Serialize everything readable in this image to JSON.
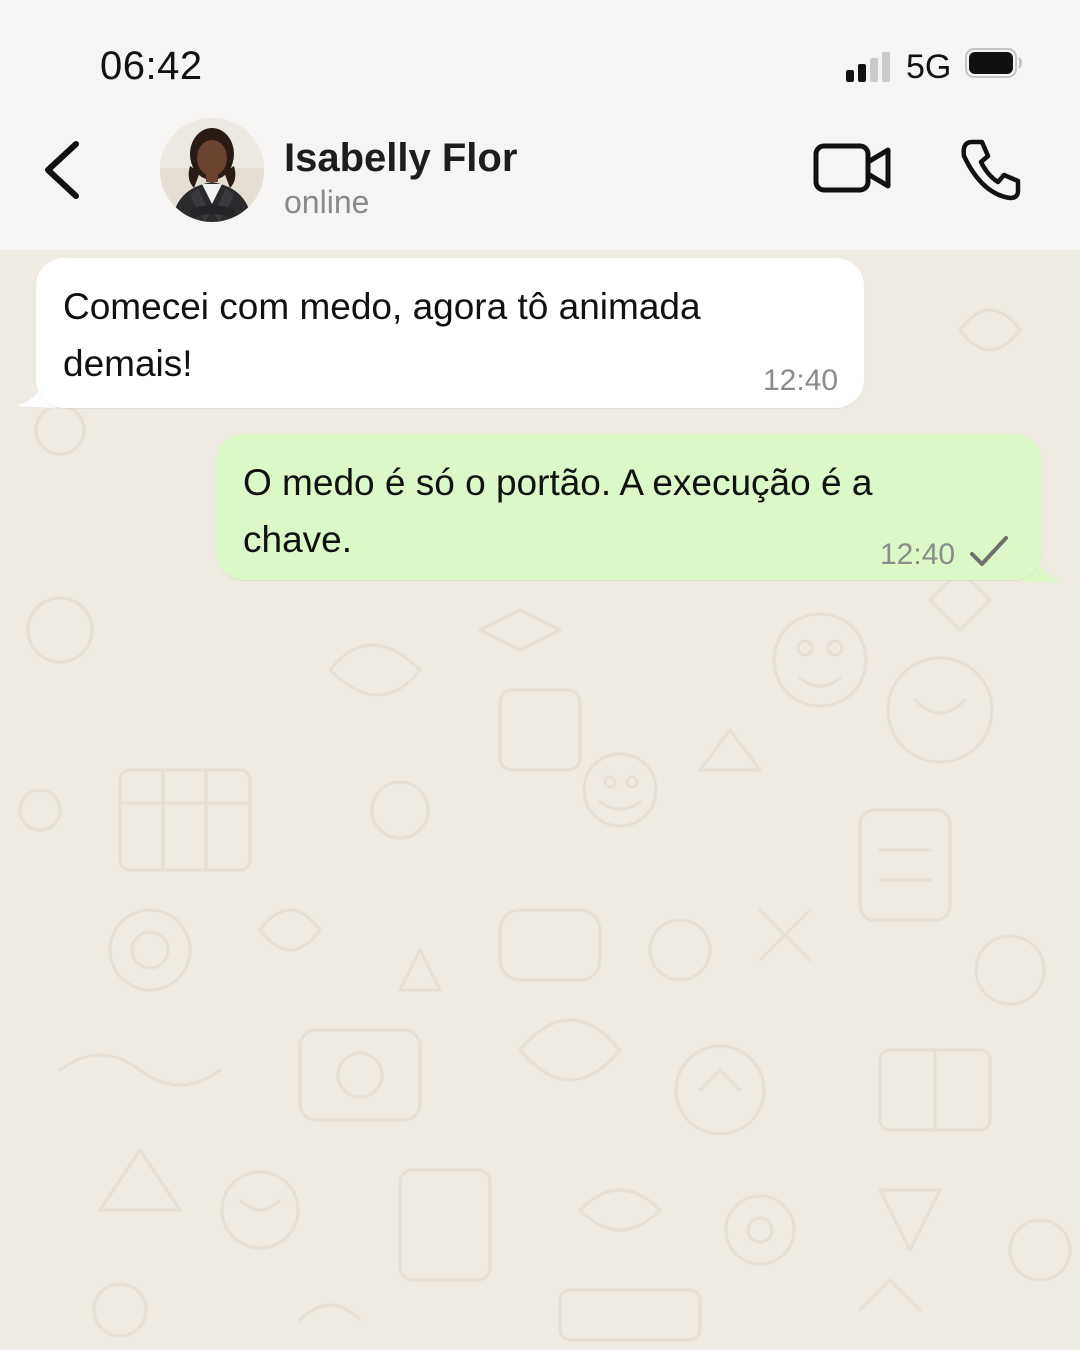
{
  "status_bar": {
    "time": "06:42",
    "network": "5G",
    "signal_icon": "signal-bars-icon",
    "battery_icon": "battery-icon"
  },
  "header": {
    "back_icon": "chevron-left-icon",
    "contact_name": "Isabelly Flor",
    "contact_status": "online",
    "video_icon": "video-camera-icon",
    "call_icon": "phone-icon"
  },
  "messages": [
    {
      "direction": "incoming",
      "lines": [
        "Comecei com medo, agora tô animada",
        "demais!"
      ],
      "time": "12:40"
    },
    {
      "direction": "outgoing",
      "lines": [
        "O medo é só o portão. A execução é a",
        "chave."
      ],
      "time": "12:40",
      "status_icon": "single-check-icon"
    }
  ],
  "colors": {
    "chat_background": "#efeae2",
    "incoming_bubble": "#ffffff",
    "outgoing_bubble": "#dcf8c6",
    "header_background": "#f6f5f3",
    "wallpaper_doodle": "#e6e0d5"
  }
}
